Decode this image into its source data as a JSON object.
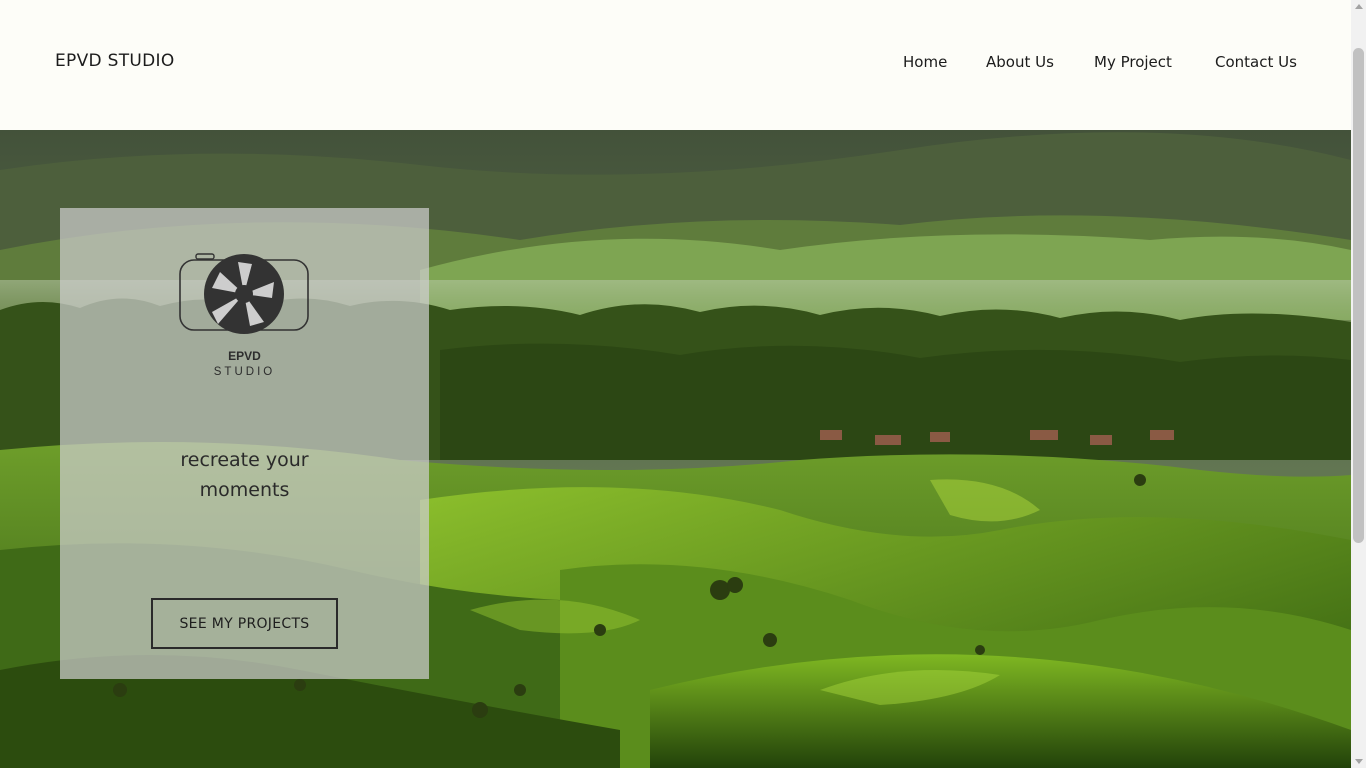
{
  "header": {
    "brand": "EPVD STUDIO",
    "nav": [
      "Home",
      "About Us",
      "My Project",
      "Contact Us"
    ]
  },
  "hero": {
    "image": "green tea plantation hills landscape",
    "card": {
      "logo_title": "EPVD",
      "logo_subtitle": "STUDIO",
      "tagline_line1": "recreate your",
      "tagline_line2": "moments",
      "cta_label": "SEE MY PROJECTS"
    }
  },
  "colors": {
    "page_background": "#fdfdf8",
    "text": "#1c1c1c",
    "card_overlay": "#cdcdcd",
    "logo": "#333333"
  }
}
